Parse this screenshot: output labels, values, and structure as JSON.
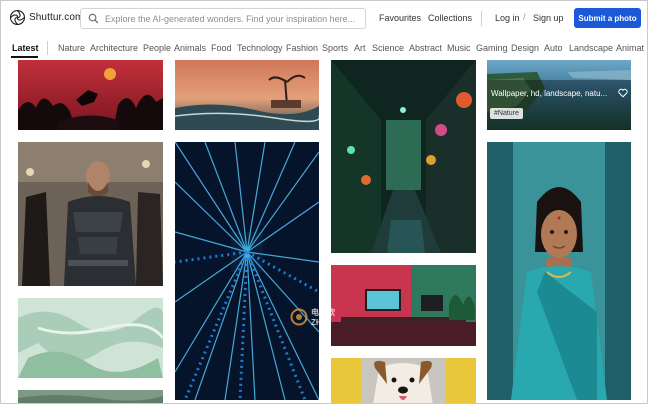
{
  "header": {
    "brand": "Shuttur.com",
    "search_placeholder": "Explore the AI-generated wonders. Find your inspiration here...",
    "favourites": "Favourites",
    "collections": "Collections",
    "login": "Log in",
    "slash": "/",
    "signup": "Sign up",
    "submit": "Submit a photo"
  },
  "categories": [
    "Latest",
    "Nature",
    "Architecture",
    "People",
    "Animals",
    "Food",
    "Technology",
    "Fashion",
    "Sports",
    "Art",
    "Science",
    "Abstract",
    "Music",
    "Gaming",
    "Design",
    "Auto",
    "Landscape",
    "Animat"
  ],
  "tiles": {
    "coastal": {
      "caption": "Wallpaper, hd, landscape, natu...",
      "tag": "#Nature"
    }
  },
  "watermark": {
    "line1": "电脑软",
    "line2": "ZH"
  },
  "colors": {
    "accent": "#1a5ad8",
    "text": "#333333"
  }
}
